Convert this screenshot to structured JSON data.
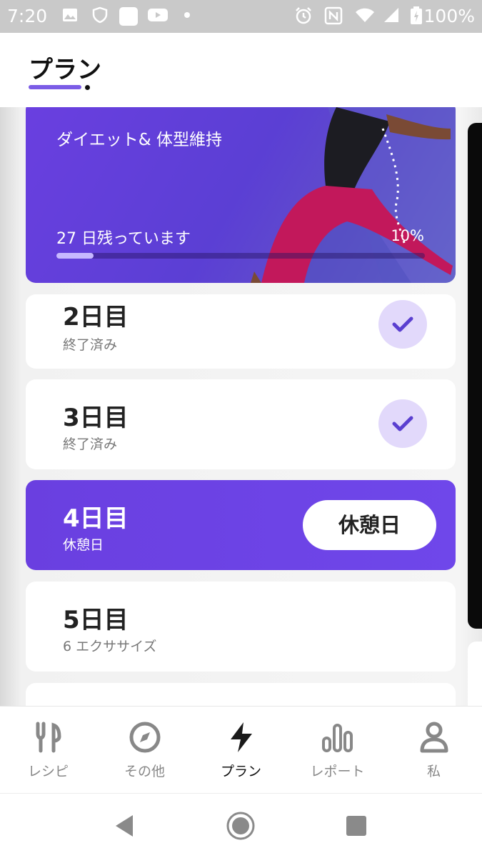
{
  "status_bar": {
    "time": "7:20",
    "battery": "100%",
    "icons": [
      "image-icon",
      "shield-icon",
      "app-icon",
      "youtube-icon",
      "dot-icon",
      "alarm-icon",
      "nfc-icon",
      "wifi-icon",
      "signal-icon",
      "battery-icon"
    ]
  },
  "header": {
    "title": "プラン"
  },
  "banner": {
    "subtitle": "ダイエット& 体型維持",
    "remaining": "27 日残っています",
    "progress_label": "10%",
    "progress_value": 0.1
  },
  "days": [
    {
      "title": "2日目",
      "subtitle": "終了済み",
      "status": "done"
    },
    {
      "title": "3日目",
      "subtitle": "終了済み",
      "status": "done"
    },
    {
      "title": "4日目",
      "subtitle": "休憩日",
      "status": "rest",
      "button": "休憩日"
    },
    {
      "title": "5日目",
      "subtitle": "6 エクササイズ",
      "status": "upcoming"
    }
  ],
  "bottom_nav": [
    {
      "label": "レシピ",
      "icon": "fork-knife-icon"
    },
    {
      "label": "その他",
      "icon": "compass-icon"
    },
    {
      "label": "プラン",
      "icon": "lightning-icon",
      "active": true
    },
    {
      "label": "レポート",
      "icon": "bar-chart-icon"
    },
    {
      "label": "私",
      "icon": "person-icon"
    }
  ],
  "colors": {
    "accent": "#6a3fe0",
    "check_bg": "#e2d9fb",
    "check": "#5a3fd0"
  }
}
